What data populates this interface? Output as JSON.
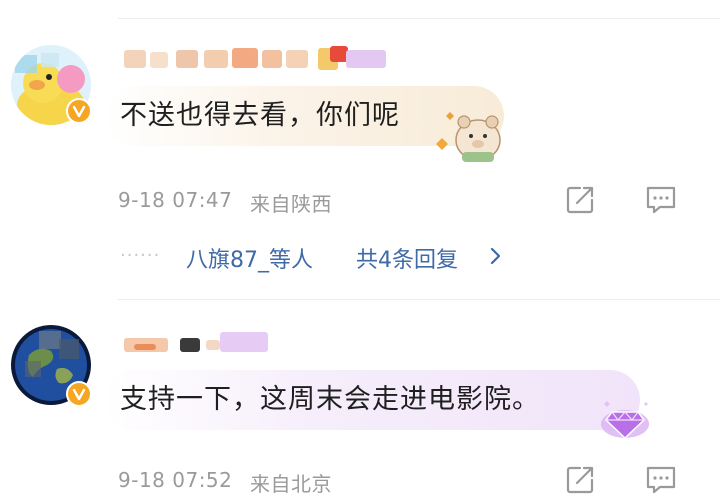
{
  "comments": [
    {
      "text": "不送也得去看，你们呢",
      "time": "9-18 07:47",
      "location": "来自陕西",
      "replies_users": "八旗87_等人",
      "replies_count": "共4条回复",
      "icons": [
        "share-icon",
        "comment-icon",
        "verified-badge-icon",
        "chevron-right-icon"
      ]
    },
    {
      "text": "支持一下，这周末会走进电影院。",
      "time": "9-18 07:52",
      "location": "来自北京",
      "icons": [
        "share-icon",
        "comment-icon",
        "verified-badge-icon",
        "diamond-icon"
      ]
    }
  ],
  "colors": {
    "link": "#3f6aa8",
    "meta": "#9a9a9a",
    "badge": "#f5a623"
  }
}
